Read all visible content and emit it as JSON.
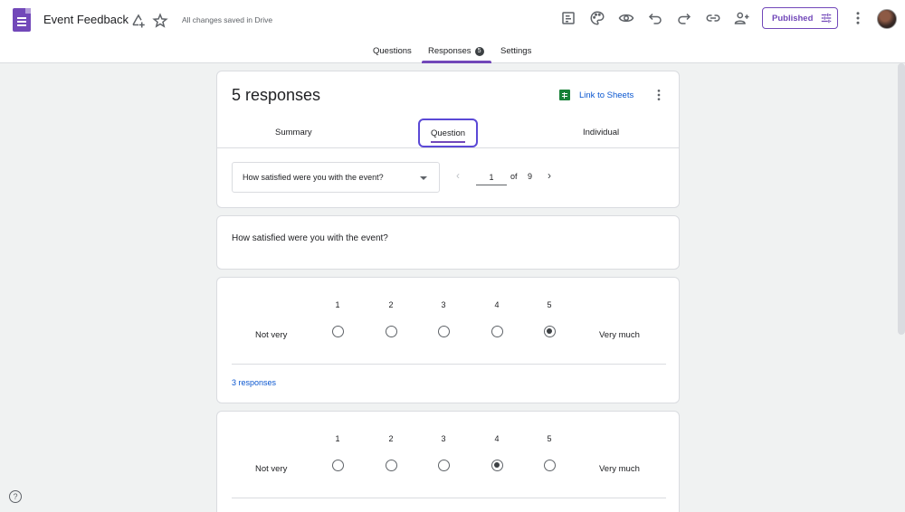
{
  "app": {
    "title": "Event Feedback",
    "saved_status": "All changes saved in Drive",
    "publish_label": "Published",
    "icons": [
      "add-to-drive-icon",
      "star-icon",
      "customize-theme-icon",
      "palette-icon",
      "preview-icon",
      "undo-icon",
      "redo-icon",
      "link-icon",
      "add-collaborator-icon",
      "tune-icon",
      "more-vert-icon"
    ]
  },
  "tabs": {
    "questions": "Questions",
    "responses": "Responses",
    "responses_count": "5",
    "settings": "Settings"
  },
  "responses": {
    "title": "5 responses",
    "link_to_sheets": "Link to Sheets",
    "subtabs": {
      "summary": "Summary",
      "question": "Question",
      "individual": "Individual"
    },
    "selected_question": "How satisfied were you with the event?",
    "pager": {
      "current": "1",
      "of": "of",
      "total": "9"
    }
  },
  "question_card": {
    "text": "How satisfied were you with the event?"
  },
  "scale_cards": [
    {
      "numbers": [
        "1",
        "2",
        "3",
        "4",
        "5"
      ],
      "low_label": "Not very",
      "high_label": "Very much",
      "selected": 5,
      "responses_label": "3 responses"
    },
    {
      "numbers": [
        "1",
        "2",
        "3",
        "4",
        "5"
      ],
      "low_label": "Not very",
      "high_label": "Very much",
      "selected": 4
    }
  ],
  "help_label": "?",
  "colors": {
    "brand": "#7248b9",
    "link": "#0b57d0",
    "sheets": "#188038",
    "background": "#f0f2f2"
  }
}
